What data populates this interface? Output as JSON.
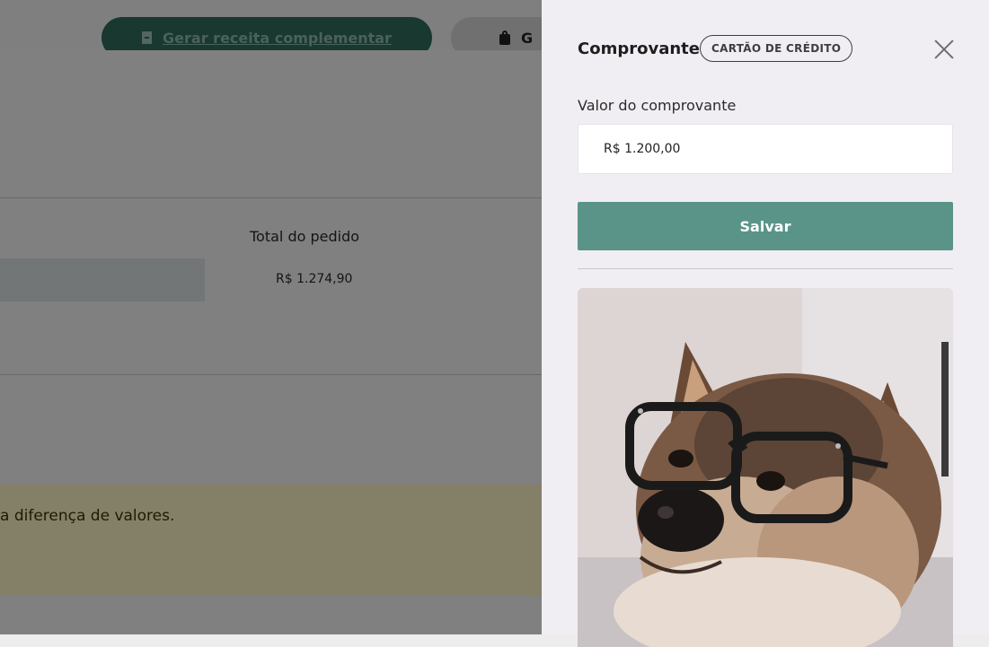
{
  "background": {
    "topbar": {
      "receita_button_label": "Gerar receita complementar",
      "other_button_label": "G"
    },
    "total": {
      "label": "Total do pedido",
      "value": "R$ 1.274,90"
    },
    "warning_text": "a diferença de valores."
  },
  "drawer": {
    "title": "Comprovante",
    "payment_chip": "CARTÃO DE CRÉDITO",
    "field_label": "Valor do comprovante",
    "field_value": "R$ 1.200,00",
    "save_label": "Salvar"
  },
  "colors": {
    "primary": "#5a9488",
    "dark_green": "#2f6b5c",
    "drawer_bg": "#f1eef3",
    "warning_bg": "#fdf6c7"
  }
}
